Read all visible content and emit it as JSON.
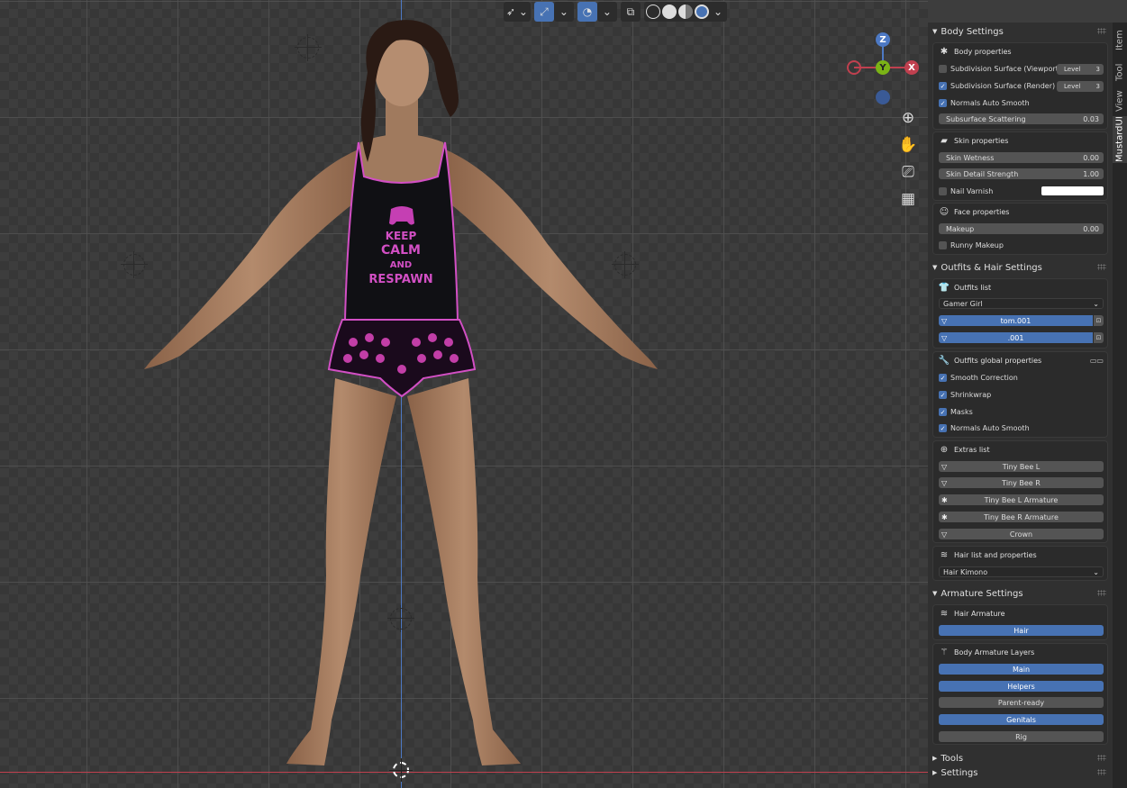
{
  "header": {
    "select_mode_icon": "cursor-select-icon",
    "gizmo_toggle_icon": "transform-gizmo-icon",
    "overlay_toggle_icon": "overlay-icon",
    "xray_icon": "xray-icon",
    "shading_modes": [
      "wireframe",
      "solid",
      "material-preview",
      "rendered"
    ],
    "active_shading": "rendered"
  },
  "gizmo": {
    "z": "Z",
    "y": "Y",
    "x": "X"
  },
  "figure": {
    "shirt_line1": "KEEP",
    "shirt_line2": "CALM",
    "shirt_line3": "AND",
    "shirt_line4": "RESPAWN"
  },
  "tabs": [
    "Item",
    "Tool",
    "View",
    "MustardUI"
  ],
  "active_tab": "MustardUI",
  "body_settings": {
    "title": "Body Settings",
    "body_properties": {
      "title": "Body properties",
      "subdiv_viewport": {
        "label": "Subdivision Surface (Viewport)",
        "checked": false,
        "level_label": "Level",
        "level": "3"
      },
      "subdiv_render": {
        "label": "Subdivision Surface (Render)",
        "checked": true,
        "level_label": "Level",
        "level": "3"
      },
      "normals": {
        "label": "Normals Auto Smooth",
        "checked": true
      },
      "sss": {
        "label": "Subsurface Scattering",
        "value": "0.03"
      }
    },
    "skin_properties": {
      "title": "Skin properties",
      "wetness": {
        "label": "Skin Wetness",
        "value": "0.00"
      },
      "detail": {
        "label": "Skin Detail Strength",
        "value": "1.00"
      },
      "nail": {
        "label": "Nail Varnish",
        "checked": false,
        "color": "#ffffff"
      }
    },
    "face_properties": {
      "title": "Face properties",
      "makeup": {
        "label": "Makeup",
        "value": "0.00"
      },
      "runny": {
        "label": "Runny Makeup",
        "checked": false
      }
    }
  },
  "outfits": {
    "title": "Outfits & Hair Settings",
    "list_title": "Outfits list",
    "selected_outfit": "Gamer Girl",
    "items": [
      ".001",
      ".001"
    ],
    "item_prefixes": [
      "tom",
      ""
    ],
    "global_title": "Outfits global properties",
    "smooth": {
      "label": "Smooth Correction",
      "checked": true
    },
    "shrinkwrap": {
      "label": "Shrinkwrap",
      "checked": true
    },
    "masks": {
      "label": "Masks",
      "checked": true
    },
    "normals": {
      "label": "Normals Auto Smooth",
      "checked": true
    },
    "extras_title": "Extras list",
    "extras": [
      "Tiny Bee L",
      "Tiny Bee R",
      "Tiny Bee L Armature",
      "Tiny Bee R Armature",
      "Crown"
    ],
    "hair_title": "Hair list and properties",
    "selected_hair": "Hair Kimono"
  },
  "armature": {
    "title": "Armature Settings",
    "hair_title": "Hair Armature",
    "hair_button": "Hair",
    "layers_title": "Body Armature Layers",
    "layers": [
      {
        "label": "Main",
        "active": true
      },
      {
        "label": "Helpers",
        "active": true
      },
      {
        "label": "Parent-ready",
        "active": false
      },
      {
        "label": "Genitals",
        "active": true
      },
      {
        "label": "Rig",
        "active": false
      }
    ]
  },
  "tools": {
    "title": "Tools"
  },
  "settings": {
    "title": "Settings"
  },
  "colors": {
    "accent": "#4772b3",
    "panel": "#303030",
    "x_axis": "#c0404f",
    "y_axis": "#7bb316",
    "z_axis": "#4d79c4",
    "shirt_text": "#d24fc4"
  }
}
